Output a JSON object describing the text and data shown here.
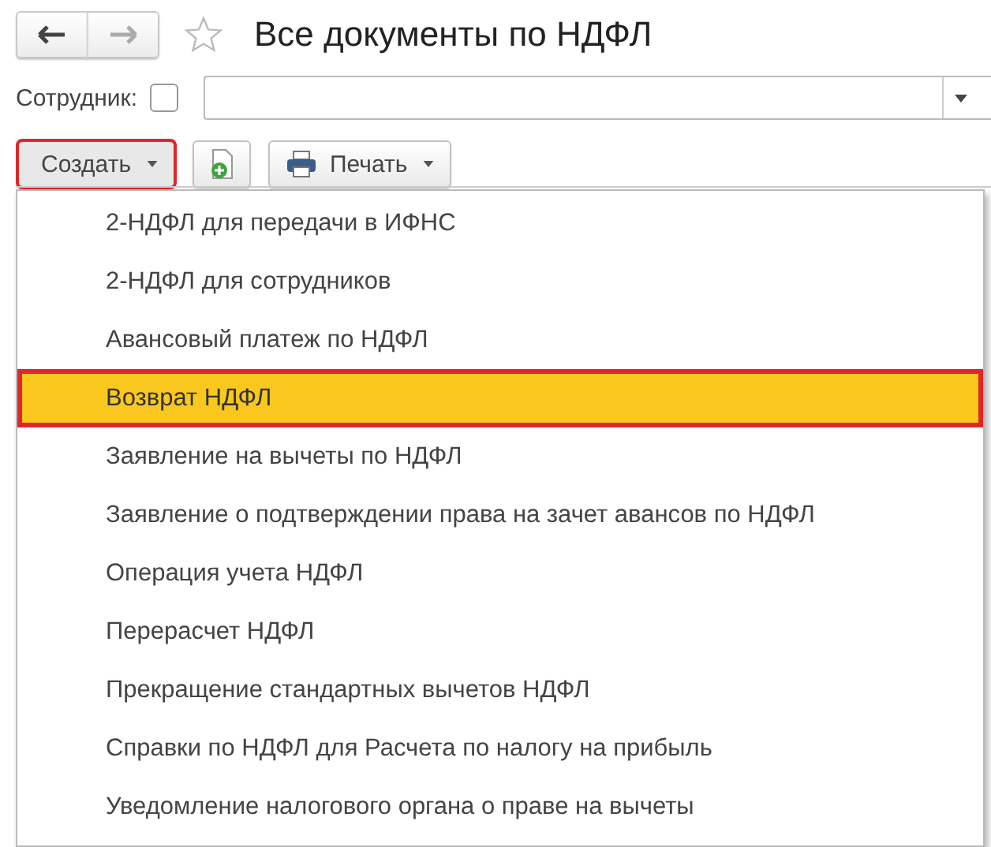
{
  "window": {
    "title": "Все документы по НДФЛ",
    "favorite": false
  },
  "filter": {
    "label": "Сотрудник:",
    "checked": false
  },
  "toolbar": {
    "create": {
      "label": "Создать",
      "focused": true
    },
    "print": {
      "label": "Печать"
    }
  },
  "menu": {
    "items": [
      {
        "label": "2-НДФЛ для передачи в ИФНС",
        "selected": false
      },
      {
        "label": "2-НДФЛ для сотрудников",
        "selected": false
      },
      {
        "label": "Авансовый платеж по НДФЛ",
        "selected": false
      },
      {
        "label": "Возврат НДФЛ",
        "selected": true
      },
      {
        "label": "Заявление на вычеты по НДФЛ",
        "selected": false
      },
      {
        "label": "Заявление о подтверждении права на зачет авансов по НДФЛ",
        "selected": false
      },
      {
        "label": "Операция учета НДФЛ",
        "selected": false
      },
      {
        "label": "Перерасчет НДФЛ",
        "selected": false
      },
      {
        "label": "Прекращение стандартных вычетов НДФЛ",
        "selected": false
      },
      {
        "label": "Справки по НДФЛ для Расчета по налогу на прибыль",
        "selected": false
      },
      {
        "label": "Уведомление налогового органа о праве на вычеты",
        "selected": false
      }
    ]
  }
}
